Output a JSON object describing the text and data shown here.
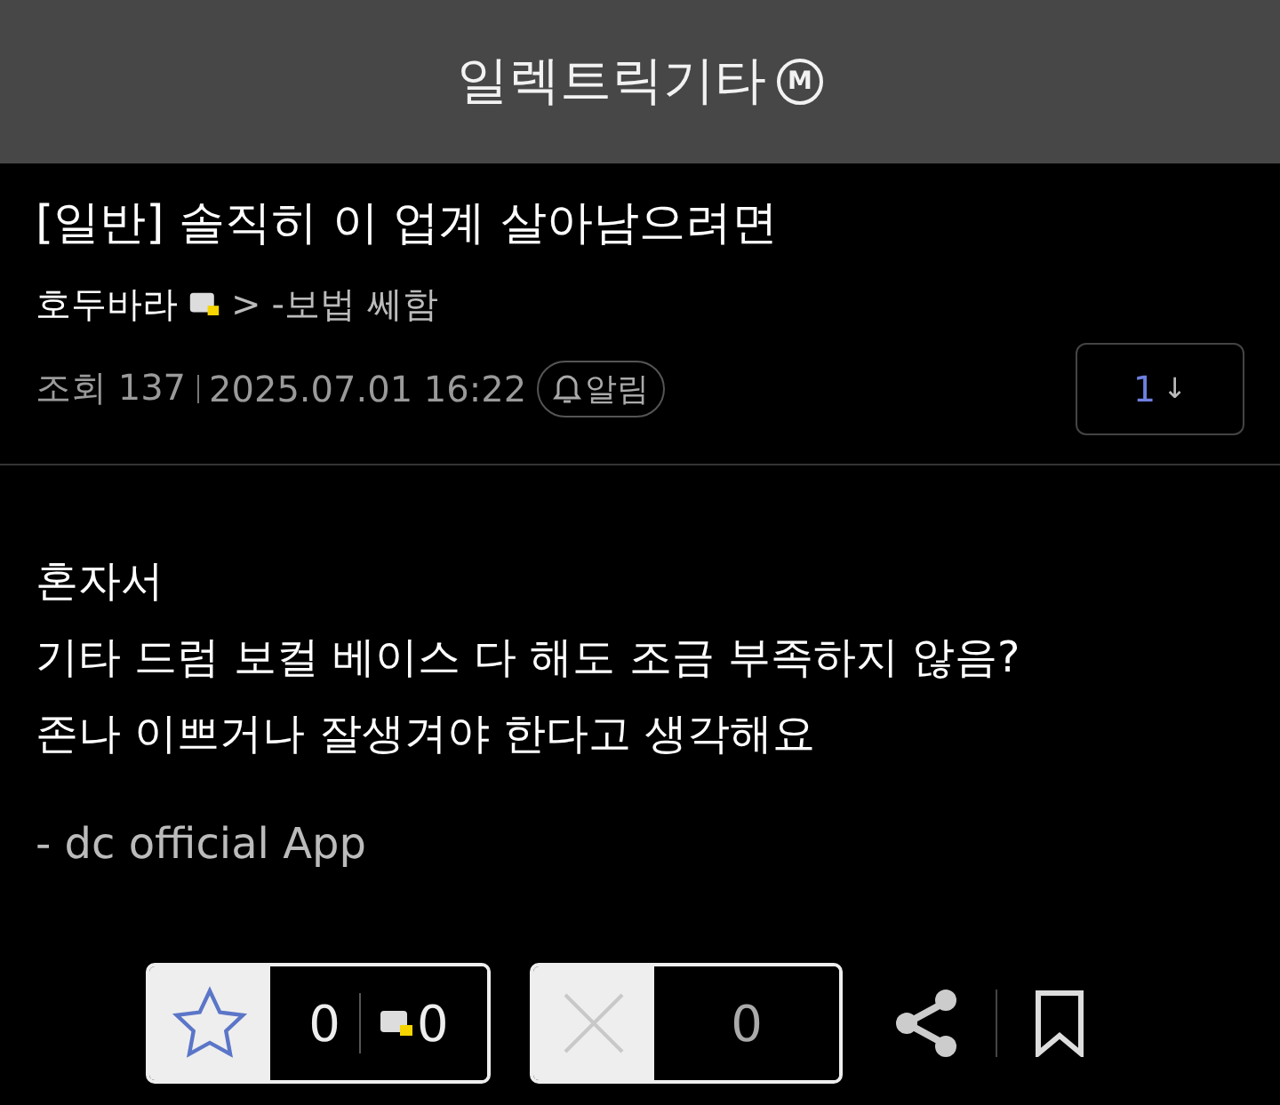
{
  "header": {
    "title": "일렉트릭기타",
    "badge": "M"
  },
  "post": {
    "title": "[일반] 솔직히 이 업계 살아남으려면",
    "author": "호두바라",
    "author_icon": true,
    "arrow": ">",
    "category": "-보법 쎄함",
    "views": "조회 137",
    "date": "2025.07.01 16:22",
    "alert": "알림",
    "comment_count": "1",
    "comment_arrow": "↓"
  },
  "body": [
    "혼자서",
    "기타 드럼 보컬 베이스 다 해도 조금 부족하지 않음?",
    "존나 이쁘거나 잘생겨야 한다고 생각해요"
  ],
  "signature": "- dc official App",
  "actions": {
    "recommend": "0",
    "fixed_recommend": "0",
    "unrecommend": "0"
  }
}
